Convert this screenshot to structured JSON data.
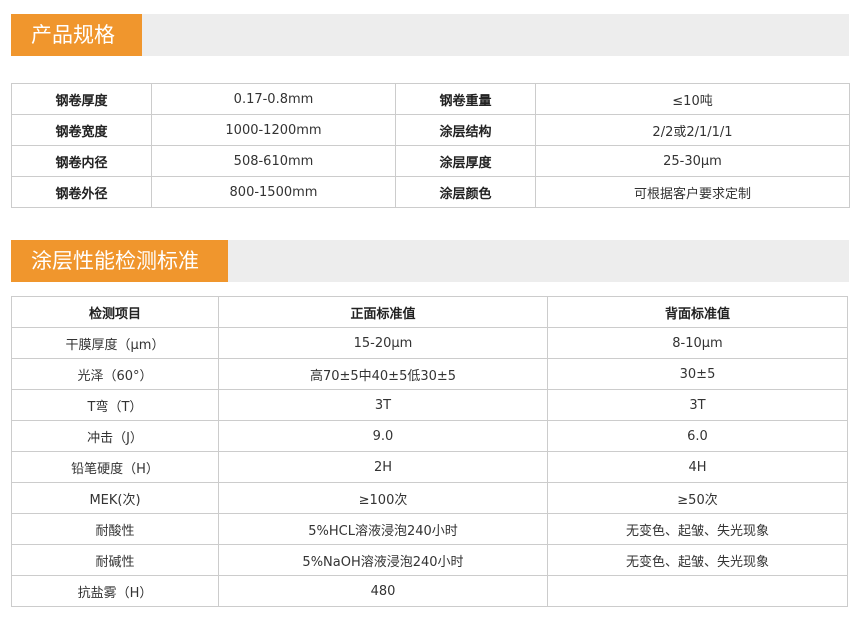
{
  "specs": {
    "title": "产品规格",
    "rows": [
      [
        "钢卷厚度",
        "0.17-0.8mm",
        "钢卷重量",
        "≤10吨"
      ],
      [
        "钢卷宽度",
        "1000-1200mm",
        "涂层结构",
        "2/2或2/1/1/1"
      ],
      [
        "钢卷内径",
        "508-610mm",
        "涂层厚度",
        "25-30μm"
      ],
      [
        "钢卷外径",
        "800-1500mm",
        "涂层颜色",
        "可根据客户要求定制"
      ]
    ]
  },
  "tests": {
    "title": "涂层性能检测标准",
    "headers": [
      "检测项目",
      "正面标准值",
      "背面标准值"
    ],
    "rows": [
      [
        "干膜厚度（μm）",
        "15-20μm",
        "8-10μm"
      ],
      [
        "光泽（60°）",
        "高70±5中40±5低30±5",
        "30±5"
      ],
      [
        "T弯（T）",
        "3T",
        "3T"
      ],
      [
        "冲击（J）",
        "9.0",
        "6.0"
      ],
      [
        "铅笔硬度（H）",
        "2H",
        "4H"
      ],
      [
        "MEK(次)",
        "≥100次",
        "≥50次"
      ],
      [
        "耐酸性",
        "5%HCL溶液浸泡240小时",
        "无变色、起皱、失光现象"
      ],
      [
        "耐碱性",
        "5%NaOH溶液浸泡240小时",
        "无变色、起皱、失光现象"
      ],
      [
        "抗盐雾（H）",
        "480",
        ""
      ]
    ]
  }
}
